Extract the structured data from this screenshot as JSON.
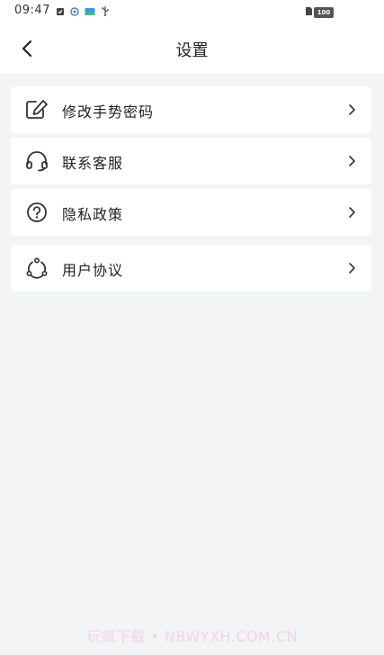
{
  "status_bar": {
    "time": "09:47",
    "battery": "100"
  },
  "header": {
    "title": "设置"
  },
  "settings": {
    "items": [
      {
        "label": "修改手势密码",
        "icon": "edit-icon"
      },
      {
        "label": "联系客服",
        "icon": "headset-icon"
      },
      {
        "label": "隐私政策",
        "icon": "question-circle-icon"
      },
      {
        "label": "用户协议",
        "icon": "agreement-icon"
      }
    ]
  },
  "watermark": "玩疯下载 • NBWYXH.COM.CN",
  "colors": {
    "page_background": "#f3f4f6",
    "card_background": "#ffffff",
    "text": "#222222",
    "icon_stroke": "#333333"
  }
}
